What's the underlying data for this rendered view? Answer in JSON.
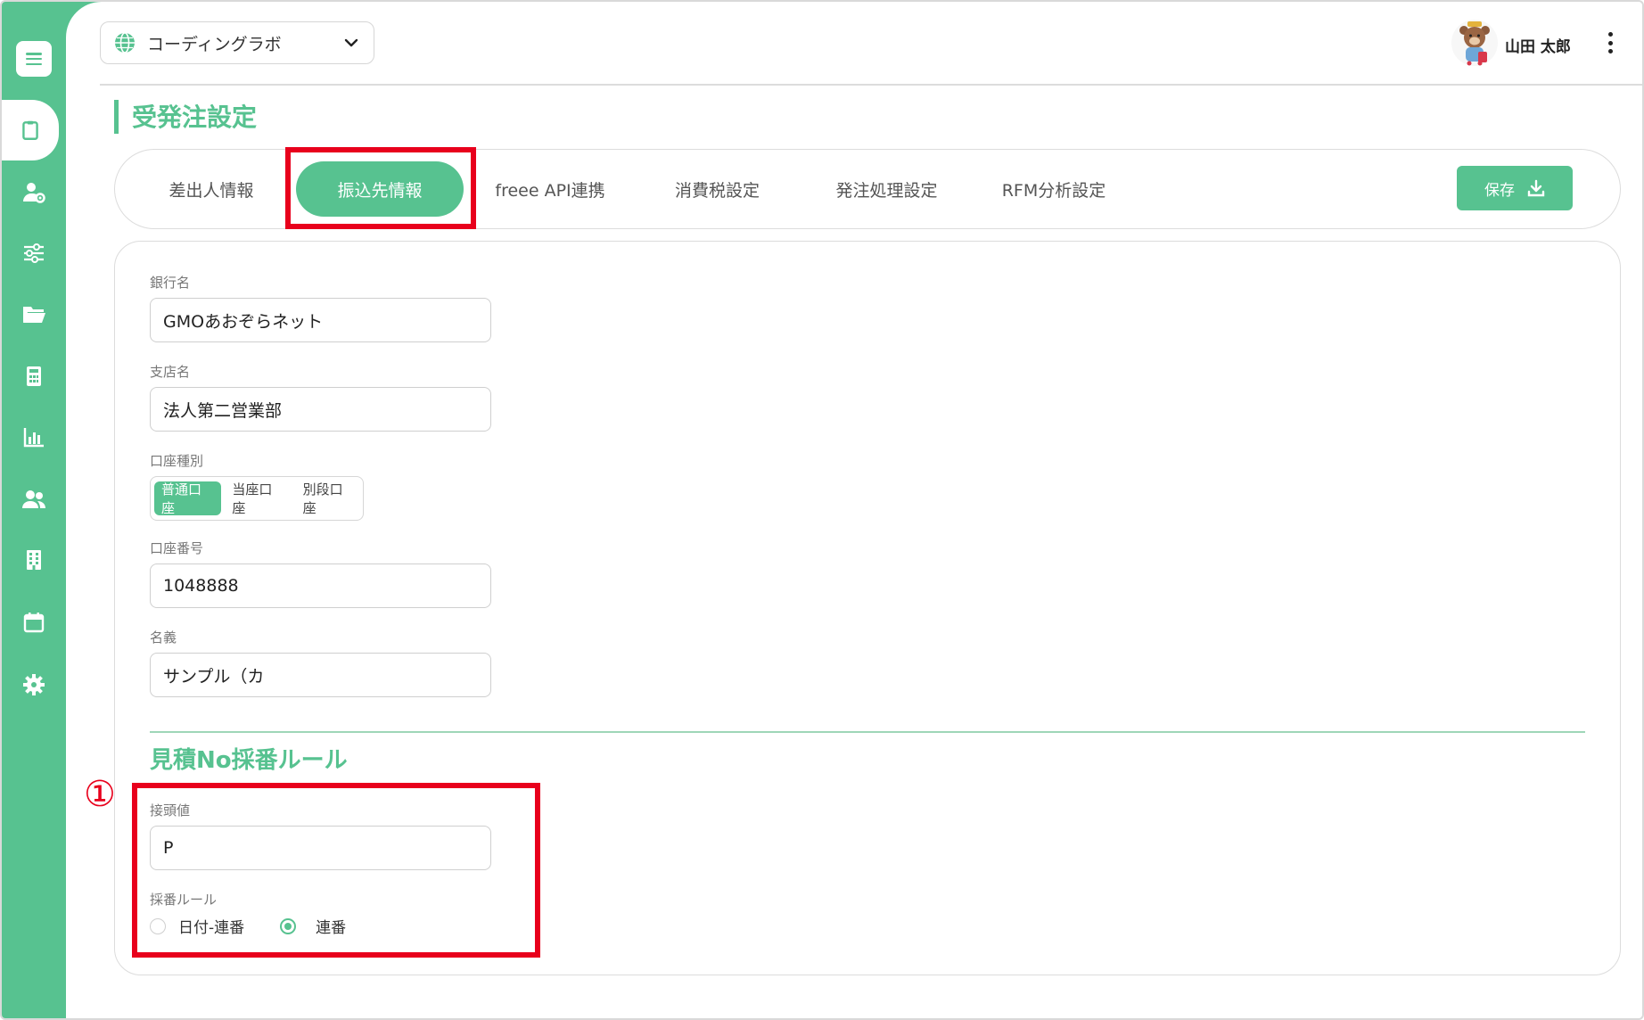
{
  "header": {
    "workspace_name": "コーディングラボ",
    "user_name": "山田 太郎"
  },
  "page_title": "受発注設定",
  "tabs": [
    {
      "label": "差出人情報",
      "active": false
    },
    {
      "label": "振込先情報",
      "active": true
    },
    {
      "label": "freee API連携",
      "active": false
    },
    {
      "label": "消費税設定",
      "active": false
    },
    {
      "label": "発注処理設定",
      "active": false
    },
    {
      "label": "RFM分析設定",
      "active": false
    }
  ],
  "save_label": "保存",
  "form": {
    "bank_name": {
      "label": "銀行名",
      "value": "GMOあおぞらネット"
    },
    "branch_name": {
      "label": "支店名",
      "value": "法人第二営業部"
    },
    "account_type": {
      "label": "口座種別",
      "options": [
        "普通口座",
        "当座口座",
        "別段口座"
      ],
      "selected": "普通口座"
    },
    "account_number": {
      "label": "口座番号",
      "value": "1048888"
    },
    "account_holder": {
      "label": "名義",
      "value": "サンプル（カ"
    }
  },
  "estimate_rule": {
    "section_title": "見積No採番ルール",
    "prefix": {
      "label": "接頭値",
      "value": "P"
    },
    "numbering": {
      "label": "採番ルール",
      "options": [
        "日付-連番",
        "連番"
      ],
      "selected": "連番"
    }
  },
  "annotation": {
    "marker": "①",
    "color": "#e8001c"
  },
  "colors": {
    "accent": "#57c290",
    "highlight": "#e8001c"
  },
  "sidebar_icons": [
    "menu-icon",
    "clipboard-icon",
    "user-settings-icon",
    "sliders-icon",
    "folder-icon",
    "calculator-icon",
    "chart-icon",
    "users-icon",
    "building-icon",
    "calendar-icon",
    "gear-icon"
  ]
}
